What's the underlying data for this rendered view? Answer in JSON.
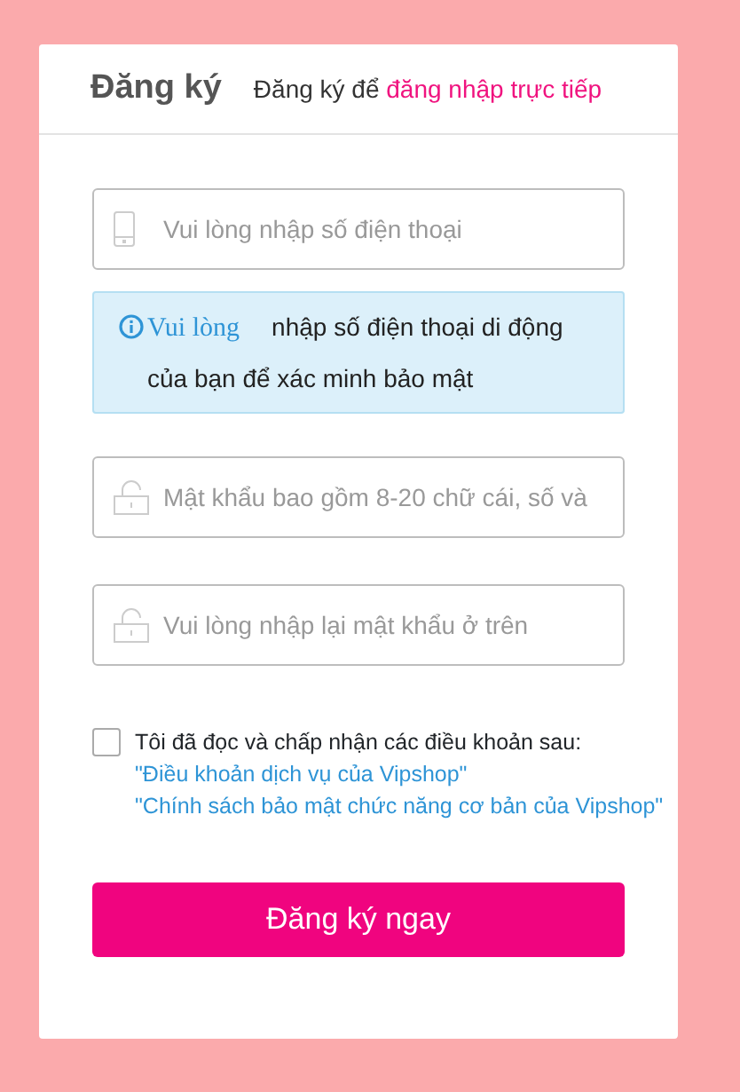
{
  "header": {
    "title": "Đăng ký",
    "subtitle": "Đăng ký để",
    "login_link": "đăng nhập trực tiếp"
  },
  "phone_field": {
    "placeholder": "Vui lòng nhập số điện thoại"
  },
  "info": {
    "lead": "Vui lòng",
    "text": "nhập số điện thoại di động của bạn để xác minh bảo mật"
  },
  "password_field": {
    "placeholder": "Mật khẩu bao gồm 8-20 chữ cái, số và"
  },
  "confirm_field": {
    "placeholder": "Vui lòng nhập lại mật khẩu ở trên"
  },
  "terms": {
    "checked": false,
    "text": "Tôi đã đọc và chấp nhận các điều khoản sau:",
    "links": [
      "\"Điều khoản dịch vụ của Vipshop\"",
      "\"Chính sách bảo mật chức năng cơ bản của Vipshop\""
    ]
  },
  "submit": "Đăng ký ngay"
}
